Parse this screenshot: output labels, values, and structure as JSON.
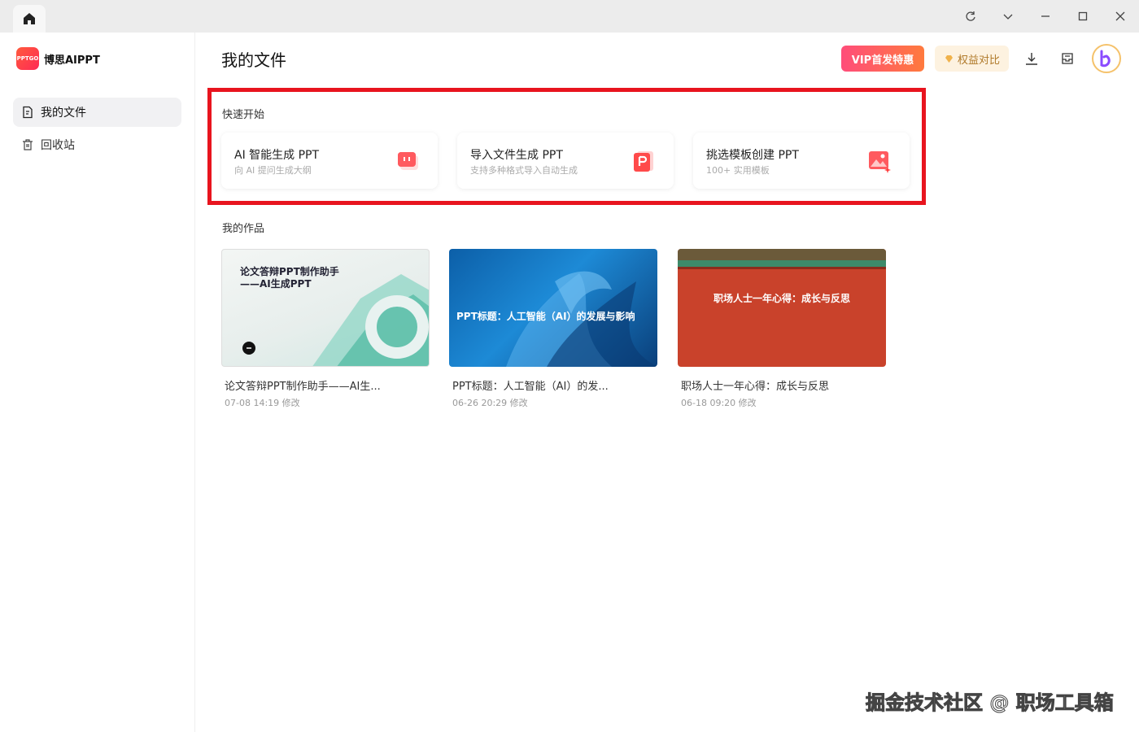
{
  "sidebar": {
    "logo_badge": "PPTGO",
    "logo_text": "博思AIPPT",
    "items": [
      {
        "label": "我的文件",
        "active": true
      },
      {
        "label": "回收站",
        "active": false
      }
    ]
  },
  "header": {
    "title": "我的文件",
    "vip_label": "VIP首发特惠",
    "rights_label": "权益对比"
  },
  "quick_start": {
    "label": "快速开始",
    "cards": [
      {
        "title": "AI 智能生成 PPT",
        "subtitle": "向 AI 提问生成大纲",
        "icon": "chat-icon"
      },
      {
        "title": "导入文件生成 PPT",
        "subtitle": "支持多种格式导入自动生成",
        "icon": "ppt-file-icon"
      },
      {
        "title": "挑选模板创建 PPT",
        "subtitle": "100+ 实用模板",
        "icon": "image-template-icon"
      }
    ]
  },
  "works": {
    "label": "我的作品",
    "items": [
      {
        "title": "论文答辩PPT制作助手——AI生...",
        "date": "07-08 14:19 修改",
        "thumb_title": "论文答辩PPT制作助手——AI生成PPT"
      },
      {
        "title": "PPT标题：人工智能（AI）的发...",
        "date": "06-26 20:29 修改",
        "thumb_title": "PPT标题：人工智能（AI）的发展与影响"
      },
      {
        "title": "职场人士一年心得：成长与反思",
        "date": "06-18 09:20 修改",
        "thumb_title": "职场人士一年心得：成长与反思"
      }
    ]
  },
  "watermark": "掘金技术社区 @ 职场工具箱",
  "colors": {
    "highlight_box": "#e8141e",
    "brand": "#ff2a55",
    "vip": "#ff5a5a"
  }
}
